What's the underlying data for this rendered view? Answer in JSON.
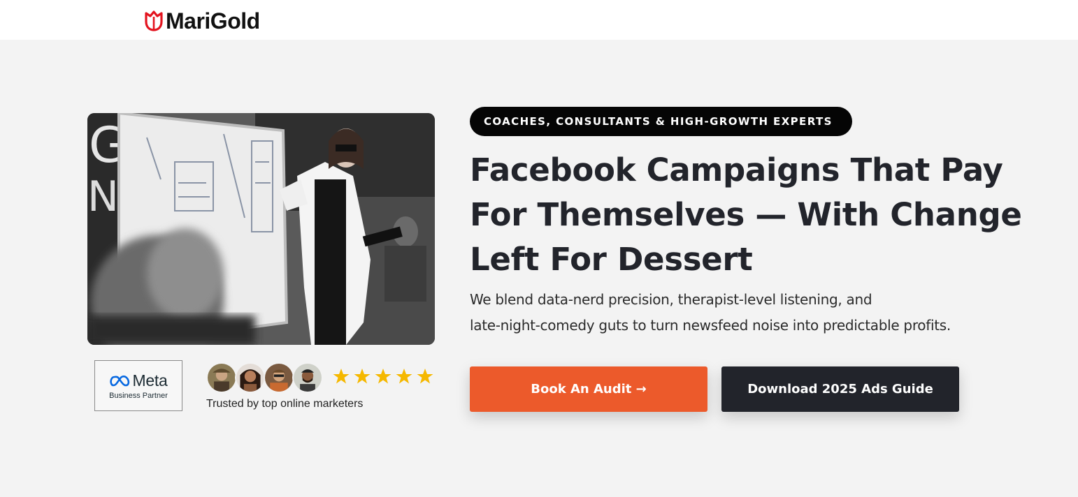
{
  "brand": {
    "name": "MariGold",
    "logo_icon": "tulip-icon",
    "accent_color": "#e3131e"
  },
  "hero": {
    "eyebrow": "COACHES, CONSULTANTS & HIGH-GROWTH EXPERTS",
    "headline_lines": [
      "Facebook Campaigns That Pay",
      "For Themselves — With Change",
      "Left For Dessert"
    ],
    "subtext_lines": [
      "We blend data-nerd precision, therapist-level listening, and",
      "late-night-comedy guts to turn newsfeed noise into predictable profits."
    ],
    "primary_cta": "Book An Audit →",
    "secondary_cta": "Download 2025 Ads Guide",
    "primary_color": "#ec5a2b",
    "secondary_color": "#22242b"
  },
  "trust": {
    "partner_badge": {
      "name": "Meta",
      "subtitle": "Business Partner",
      "icon": "meta-infinity-icon"
    },
    "rating_stars": 5,
    "star_color": "#f5b800",
    "caption": "Trusted by top online marketers",
    "avatar_count": 4
  },
  "photo": {
    "icon": "presenter-photo"
  }
}
